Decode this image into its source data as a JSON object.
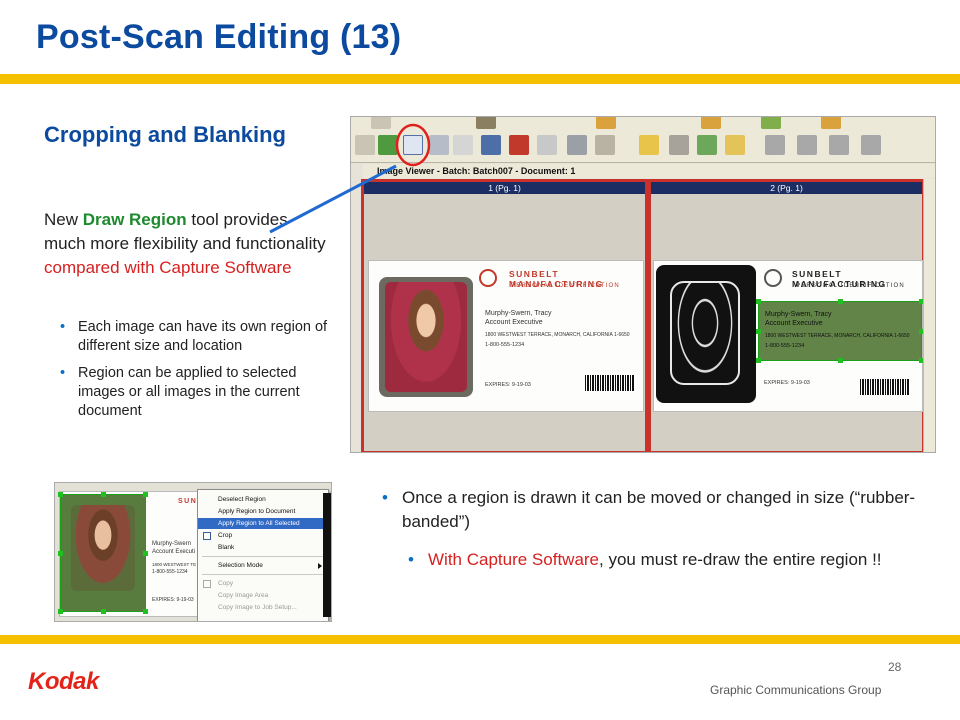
{
  "slide": {
    "title": "Post-Scan Editing  (13)",
    "subtitle": "Cropping and Blanking",
    "lead": {
      "part1": "New ",
      "highlight": "Draw Region",
      "part2": " tool provides much more flexibility and functionality ",
      "red": "compared with Capture Software"
    },
    "bullets": [
      "Each image can have its own region of different size and location",
      "Region can be applied to selected images or all images in the current document"
    ],
    "right_bullets": {
      "main": "Once a region is drawn it can be moved or changed in size (“rubber-banded”)",
      "sub_red": "With Capture Software",
      "sub_rest": ", you must re-draw the entire region !!"
    }
  },
  "screenshot": {
    "viewer_title": "Image Viewer - Batch: Batch007 - Document: 1",
    "pane1_label": "1 (Pg. 1)",
    "pane2_label": "2 (Pg. 1)",
    "card_brand": "SUNBELT MANUFACTURING",
    "card_sub": "PERSONAL IDENTIFICATION",
    "card_name": "Murphy-Swern, Tracy",
    "card_role": "Account Executive",
    "card_address": "1800 WESTWEST TERRACE, MONARCH, CALIFORNIA 1-6650",
    "card_phone": "1-800-555-1234",
    "card_expires": "EXPIRES: 9-19-03",
    "card_role2": "Account Executive"
  },
  "context_menu": {
    "items": [
      "Deselect Region",
      "Apply Region to Document",
      "Apply Region to All Selected",
      "Crop",
      "Blank",
      "Selection Mode",
      "Copy",
      "Copy Image Area",
      "Copy Image to Job Setup..."
    ],
    "highlighted_index": 2,
    "small_card": {
      "brand": "SUNB",
      "name": "Murphy-Swern",
      "role": "Account Executi",
      "address": "1800 WESTWEST TE",
      "phone": "1-800-555-1234",
      "expires": "EXPIRES: 9-19-03"
    }
  },
  "footer": {
    "page_number": "28",
    "org": "Graphic Communications Group",
    "logo": "Kodak"
  },
  "colors": {
    "title_blue": "#0b4a9e",
    "accent_yellow": "#f5c000",
    "highlight_green": "#1e8a2e",
    "alert_red": "#d6201f",
    "kodak_red": "#e2231a"
  }
}
